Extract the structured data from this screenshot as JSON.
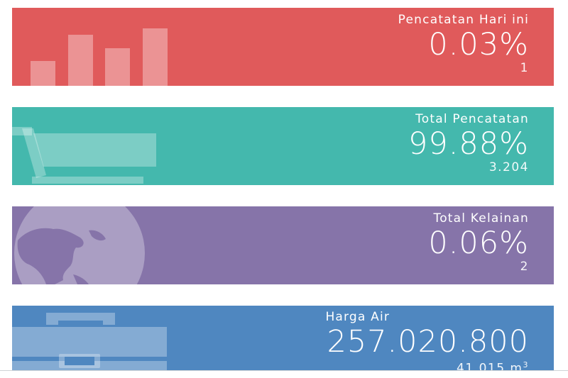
{
  "cards": [
    {
      "label": "Pencatatan Hari ini",
      "value": "0.03%",
      "count": "1",
      "color": "#e05a5b",
      "icon": "bar-chart-icon"
    },
    {
      "label": "Total Pencatatan",
      "value": "99.88%",
      "count": "3.204",
      "color": "#44b8ad",
      "icon": "shopping-cart-icon"
    },
    {
      "label": "Total Kelainan",
      "value": "0.06%",
      "count": "2",
      "color": "#8674a9",
      "icon": "globe-icon"
    },
    {
      "label": "Harga Air",
      "value": "257.020.800",
      "count": "41.015 m",
      "count_unit_sup": "3",
      "color": "#4f87c0",
      "icon": "briefcase-icon"
    }
  ]
}
